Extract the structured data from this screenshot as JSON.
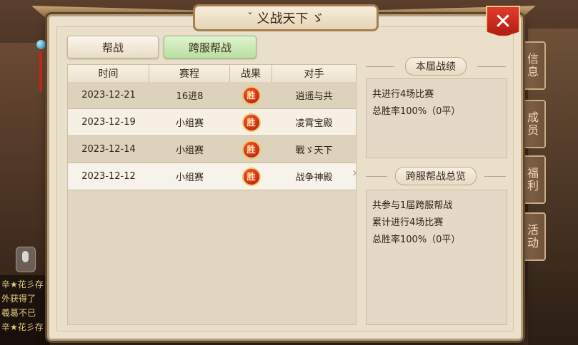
{
  "window": {
    "title": "义战天下",
    "title_decor_left": "ˇ",
    "title_decor_right": "ゞ"
  },
  "close": {
    "label": "✕"
  },
  "tabs": [
    {
      "label": "帮战",
      "active": false
    },
    {
      "label": "跨服帮战",
      "active": true
    }
  ],
  "table": {
    "headers": [
      "时间",
      "赛程",
      "战果",
      "对手"
    ],
    "rows": [
      {
        "date": "2023-12-21",
        "stage": "16进8",
        "result": "胜",
        "opponent": "逍遥与共"
      },
      {
        "date": "2023-12-19",
        "stage": "小组赛",
        "result": "胜",
        "opponent": "凌霄宝殿"
      },
      {
        "date": "2023-12-14",
        "stage": "小组赛",
        "result": "胜",
        "opponent": "戰ゞ天下"
      },
      {
        "date": "2023-12-12",
        "stage": "小组赛",
        "result": "胜",
        "opponent": "战争神殿"
      }
    ]
  },
  "current_season": {
    "title": "本届战绩",
    "lines": [
      "共进行4场比赛",
      "总胜率100%（0平）"
    ]
  },
  "overview": {
    "title": "跨服帮战总览",
    "lines": [
      "共参与1届跨服帮战",
      "累计进行4场比赛",
      "总胜率100%（0平）"
    ]
  },
  "side_tabs": [
    "信息",
    "成员",
    "福利",
    "活动"
  ],
  "chat": {
    "lines": [
      "辛★花彡存",
      "外获得了",
      "羲葛不已",
      "辛★花彡存"
    ]
  },
  "colors": {
    "panel_bg": "#ece1cc",
    "active_tab": "#b9e0a1",
    "win_badge": "#c81e12",
    "close_red": "#d22d1f"
  }
}
